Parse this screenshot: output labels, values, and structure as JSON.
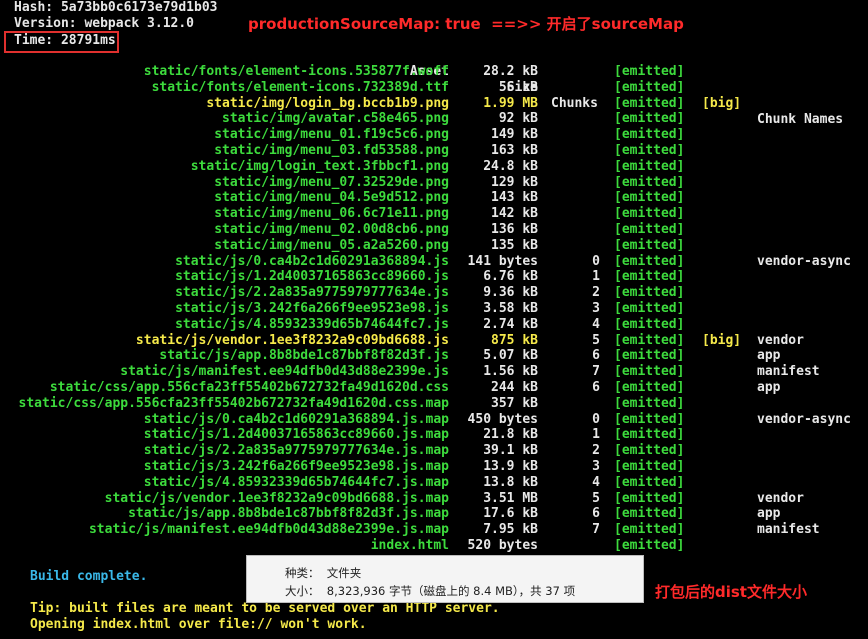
{
  "header": {
    "hash": "Hash: 5a73bb0c6173e79d1b03",
    "version": "Version: webpack 3.12.0",
    "time": "Time: 28791ms"
  },
  "annotations": {
    "source_map": "productionSourceMap: true  ==>> 开启了sourceMap",
    "dist_size": "打包后的dist文件大小"
  },
  "columns": {
    "asset": "Asset",
    "size": "Size",
    "chunks": "Chunks",
    "chunk_names": "Chunk Names"
  },
  "rows": [
    {
      "asset": "static/fonts/element-icons.535877f.woff",
      "size": "28.2 kB",
      "chunk": "",
      "emitted": "[emitted]",
      "big": "",
      "name": "",
      "highlight": false
    },
    {
      "asset": "static/fonts/element-icons.732389d.ttf",
      "size": "56 kB",
      "chunk": "",
      "emitted": "[emitted]",
      "big": "",
      "name": "",
      "highlight": false
    },
    {
      "asset": "static/img/login_bg.bccb1b9.png",
      "size": "1.99 MB",
      "chunk": "",
      "emitted": "[emitted]",
      "big": "[big]",
      "name": "",
      "highlight": true
    },
    {
      "asset": "static/img/avatar.c58e465.png",
      "size": "92 kB",
      "chunk": "",
      "emitted": "[emitted]",
      "big": "",
      "name": "",
      "highlight": false
    },
    {
      "asset": "static/img/menu_01.f19c5c6.png",
      "size": "149 kB",
      "chunk": "",
      "emitted": "[emitted]",
      "big": "",
      "name": "",
      "highlight": false
    },
    {
      "asset": "static/img/menu_03.fd53588.png",
      "size": "163 kB",
      "chunk": "",
      "emitted": "[emitted]",
      "big": "",
      "name": "",
      "highlight": false
    },
    {
      "asset": "static/img/login_text.3fbbcf1.png",
      "size": "24.8 kB",
      "chunk": "",
      "emitted": "[emitted]",
      "big": "",
      "name": "",
      "highlight": false
    },
    {
      "asset": "static/img/menu_07.32529de.png",
      "size": "129 kB",
      "chunk": "",
      "emitted": "[emitted]",
      "big": "",
      "name": "",
      "highlight": false
    },
    {
      "asset": "static/img/menu_04.5e9d512.png",
      "size": "143 kB",
      "chunk": "",
      "emitted": "[emitted]",
      "big": "",
      "name": "",
      "highlight": false
    },
    {
      "asset": "static/img/menu_06.6c71e11.png",
      "size": "142 kB",
      "chunk": "",
      "emitted": "[emitted]",
      "big": "",
      "name": "",
      "highlight": false
    },
    {
      "asset": "static/img/menu_02.00d8cb6.png",
      "size": "136 kB",
      "chunk": "",
      "emitted": "[emitted]",
      "big": "",
      "name": "",
      "highlight": false
    },
    {
      "asset": "static/img/menu_05.a2a5260.png",
      "size": "135 kB",
      "chunk": "",
      "emitted": "[emitted]",
      "big": "",
      "name": "",
      "highlight": false
    },
    {
      "asset": "static/js/0.ca4b2c1d60291a368894.js",
      "size": "141 bytes",
      "chunk": "0",
      "emitted": "[emitted]",
      "big": "",
      "name": "vendor-async",
      "highlight": false
    },
    {
      "asset": "static/js/1.2d40037165863cc89660.js",
      "size": "6.76 kB",
      "chunk": "1",
      "emitted": "[emitted]",
      "big": "",
      "name": "",
      "highlight": false
    },
    {
      "asset": "static/js/2.2a835a9775979777634e.js",
      "size": "9.36 kB",
      "chunk": "2",
      "emitted": "[emitted]",
      "big": "",
      "name": "",
      "highlight": false
    },
    {
      "asset": "static/js/3.242f6a266f9ee9523e98.js",
      "size": "3.58 kB",
      "chunk": "3",
      "emitted": "[emitted]",
      "big": "",
      "name": "",
      "highlight": false
    },
    {
      "asset": "static/js/4.85932339d65b74644fc7.js",
      "size": "2.74 kB",
      "chunk": "4",
      "emitted": "[emitted]",
      "big": "",
      "name": "",
      "highlight": false
    },
    {
      "asset": "static/js/vendor.1ee3f8232a9c09bd6688.js",
      "size": "875 kB",
      "chunk": "5",
      "emitted": "[emitted]",
      "big": "[big]",
      "name": "vendor",
      "highlight": true
    },
    {
      "asset": "static/js/app.8b8bde1c87bbf8f82d3f.js",
      "size": "5.07 kB",
      "chunk": "6",
      "emitted": "[emitted]",
      "big": "",
      "name": "app",
      "highlight": false
    },
    {
      "asset": "static/js/manifest.ee94dfb0d43d88e2399e.js",
      "size": "1.56 kB",
      "chunk": "7",
      "emitted": "[emitted]",
      "big": "",
      "name": "manifest",
      "highlight": false
    },
    {
      "asset": "static/css/app.556cfa23ff55402b672732fa49d1620d.css",
      "size": "244 kB",
      "chunk": "6",
      "emitted": "[emitted]",
      "big": "",
      "name": "app",
      "highlight": false
    },
    {
      "asset": "static/css/app.556cfa23ff55402b672732fa49d1620d.css.map",
      "size": "357 kB",
      "chunk": "",
      "emitted": "[emitted]",
      "big": "",
      "name": "",
      "highlight": false
    },
    {
      "asset": "static/js/0.ca4b2c1d60291a368894.js.map",
      "size": "450 bytes",
      "chunk": "0",
      "emitted": "[emitted]",
      "big": "",
      "name": "vendor-async",
      "highlight": false
    },
    {
      "asset": "static/js/1.2d40037165863cc89660.js.map",
      "size": "21.8 kB",
      "chunk": "1",
      "emitted": "[emitted]",
      "big": "",
      "name": "",
      "highlight": false
    },
    {
      "asset": "static/js/2.2a835a9775979777634e.js.map",
      "size": "39.1 kB",
      "chunk": "2",
      "emitted": "[emitted]",
      "big": "",
      "name": "",
      "highlight": false
    },
    {
      "asset": "static/js/3.242f6a266f9ee9523e98.js.map",
      "size": "13.9 kB",
      "chunk": "3",
      "emitted": "[emitted]",
      "big": "",
      "name": "",
      "highlight": false
    },
    {
      "asset": "static/js/4.85932339d65b74644fc7.js.map",
      "size": "13.8 kB",
      "chunk": "4",
      "emitted": "[emitted]",
      "big": "",
      "name": "",
      "highlight": false
    },
    {
      "asset": "static/js/vendor.1ee3f8232a9c09bd6688.js.map",
      "size": "3.51 MB",
      "chunk": "5",
      "emitted": "[emitted]",
      "big": "",
      "name": "vendor",
      "highlight": false
    },
    {
      "asset": "static/js/app.8b8bde1c87bbf8f82d3f.js.map",
      "size": "17.6 kB",
      "chunk": "6",
      "emitted": "[emitted]",
      "big": "",
      "name": "app",
      "highlight": false
    },
    {
      "asset": "static/js/manifest.ee94dfb0d43d88e2399e.js.map",
      "size": "7.95 kB",
      "chunk": "7",
      "emitted": "[emitted]",
      "big": "",
      "name": "manifest",
      "highlight": false
    },
    {
      "asset": "index.html",
      "size": "520 bytes",
      "chunk": "",
      "emitted": "[emitted]",
      "big": "",
      "name": "",
      "highlight": false
    }
  ],
  "footer": {
    "build_complete": "Build complete.",
    "tip_line1": "Tip: built files are meant to be served over an HTTP server.",
    "tip_line2": "Opening index.html over file:// won't work."
  },
  "info_panel": {
    "kind_line": "种类：  文件夹",
    "size_line": "大小：  8,323,936 字节（磁盘上的 8.4 MB），共 37 项"
  },
  "colors": {
    "green": "#3ddb3d",
    "yellow": "#f5e94a",
    "red": "#ff2a2a",
    "cyan": "#3ab8e8"
  }
}
